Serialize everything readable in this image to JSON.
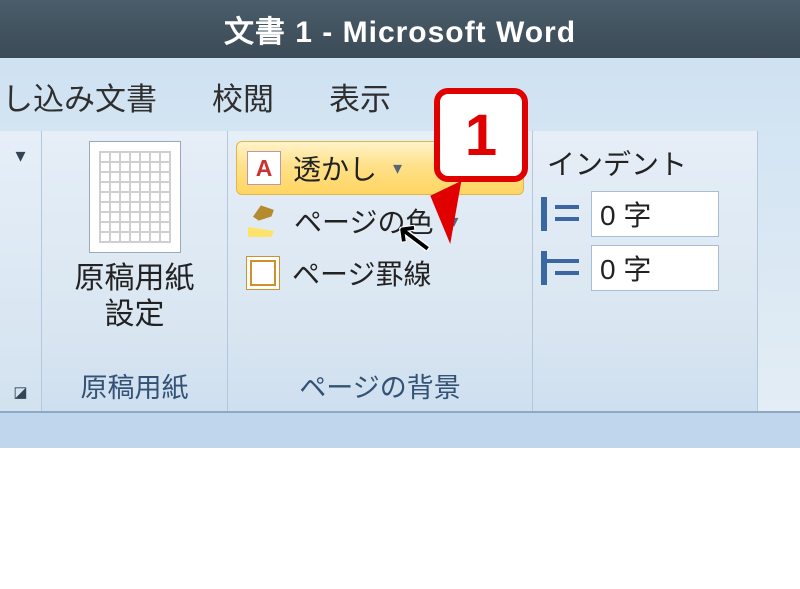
{
  "title": "文書 1 - Microsoft Word",
  "tabs": {
    "mailings": "し込み文書",
    "review": "校閲",
    "view": "表示"
  },
  "groups": {
    "genkou": {
      "button": "原稿用紙\n設定",
      "label": "原稿用紙"
    },
    "page": {
      "watermark": "透かし",
      "page_color": "ページの色",
      "page_border": "ページ罫線",
      "label": "ページの背景"
    },
    "indent": {
      "title": "インデント",
      "left_value": "0 字",
      "right_value": "0 字"
    }
  },
  "callout": "1"
}
